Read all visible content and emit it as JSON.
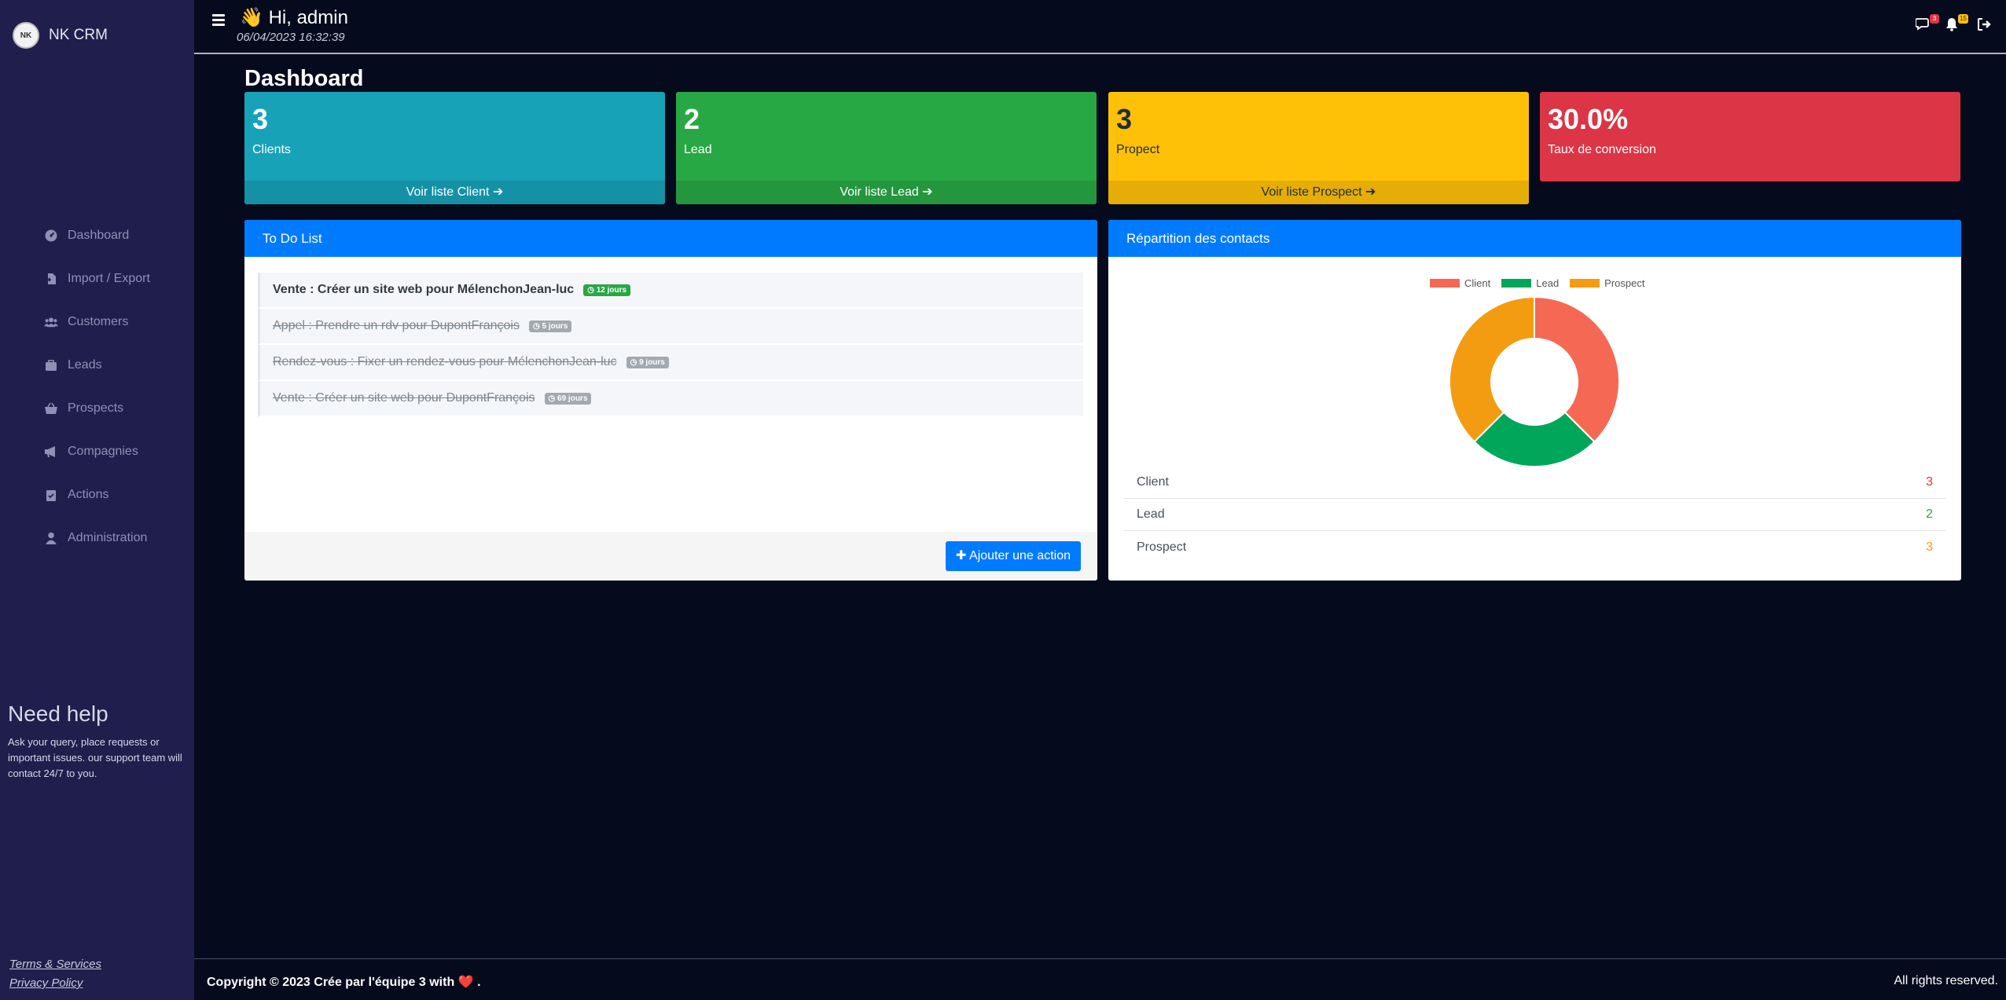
{
  "brand": {
    "logo_text": "NK",
    "name": "NK CRM"
  },
  "sidebar": {
    "items": [
      {
        "label": "Dashboard",
        "icon": "dashboard-icon"
      },
      {
        "label": "Import / Export",
        "icon": "file-import-icon"
      },
      {
        "label": "Customers",
        "icon": "users-icon"
      },
      {
        "label": "Leads",
        "icon": "briefcase-icon"
      },
      {
        "label": "Prospects",
        "icon": "basket-icon"
      },
      {
        "label": "Compagnies",
        "icon": "megaphone-icon"
      },
      {
        "label": "Actions",
        "icon": "clipboard-check-icon"
      },
      {
        "label": "Administration",
        "icon": "user-icon"
      }
    ],
    "help_title": "Need help",
    "help_text": "Ask your query, place requests or important issues. our support team will contact 24/7 to you.",
    "terms_label": "Terms & Services",
    "privacy_label": "Privacy Policy"
  },
  "header": {
    "wave": "👋",
    "greeting": "Hi, admin",
    "datetime": "06/04/2023 16:32:39",
    "messages_badge": "3",
    "notifications_badge": "15"
  },
  "dashboard": {
    "title": "Dashboard",
    "cards": [
      {
        "value": "3",
        "label": "Clients",
        "link": "Voir liste Client"
      },
      {
        "value": "2",
        "label": "Lead",
        "link": "Voir liste Lead"
      },
      {
        "value": "3",
        "label": "Propect",
        "link": "Voir liste Prospect"
      },
      {
        "value": "30.0%",
        "label": "Taux de conversion"
      }
    ]
  },
  "todo": {
    "title": "To Do List",
    "items": [
      {
        "text": "Vente : Créer un site web pour MélenchonJean-luc",
        "badge": "12 jours",
        "done": false
      },
      {
        "text": "Appel : Prendre un rdv pour DupontFrançois",
        "badge": "5 jours",
        "done": true
      },
      {
        "text": "Rendez-vous : Fixer un rendez-vous pour MélenchonJean-luc",
        "badge": "9 jours",
        "done": true
      },
      {
        "text": "Vente : Créer un site web pour DupontFrançois",
        "badge": "69 jours",
        "done": true
      }
    ],
    "add_button": "Ajouter une action"
  },
  "repartition": {
    "title": "Répartition des contacts",
    "rows": [
      {
        "label": "Client",
        "value": "3"
      },
      {
        "label": "Lead",
        "value": "2"
      },
      {
        "label": "Prospect",
        "value": "3"
      }
    ]
  },
  "chart_data": {
    "type": "pie",
    "categories": [
      "Client",
      "Lead",
      "Prospect"
    ],
    "values": [
      3,
      2,
      3
    ],
    "colors": [
      "#f56954",
      "#00a65a",
      "#f39c12"
    ],
    "legend": "top"
  },
  "footer": {
    "copyright": "Copyright © 2023 Crée par l'équipe 3 with",
    "heart": "❤️",
    "period": ".",
    "rights": "All rights reserved."
  }
}
